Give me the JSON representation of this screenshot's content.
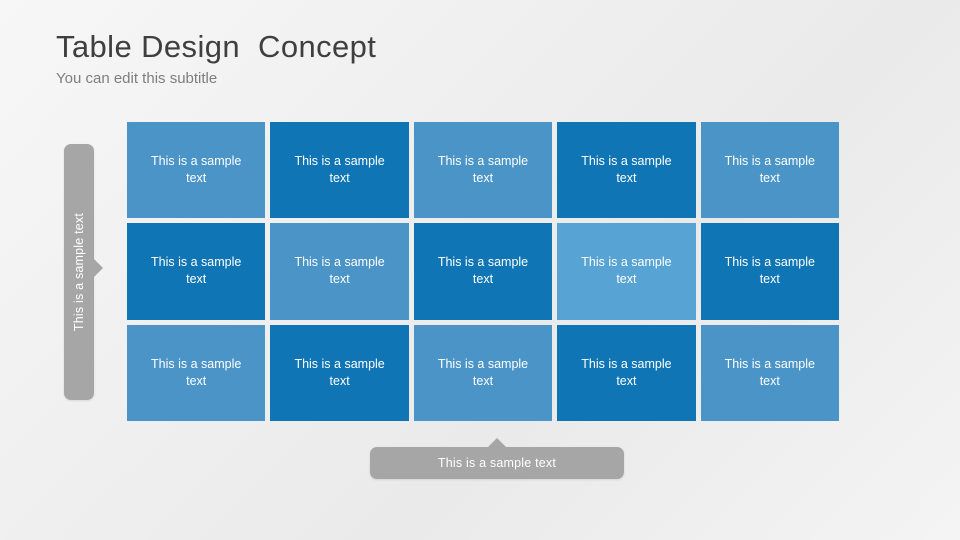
{
  "slide": {
    "background_top": "#f7f7f7",
    "background_bottom": "#eaeaea"
  },
  "header": {
    "title": "Table Design  Concept",
    "subtitle": "You can edit this subtitle",
    "title_color": "#3f3f3f",
    "subtitle_color": "#7e7e7e"
  },
  "row_label": {
    "text": "This is a sample text",
    "color": "#a6a6a6",
    "text_color": "#ffffff"
  },
  "col_label": {
    "text": "This is a sample text",
    "color": "#a6a6a6",
    "text_color": "#ffffff"
  },
  "palette": {
    "light_blue": "#4a94c8",
    "dark_blue": "#0f75b5",
    "highlight_blue": "#56a3d4",
    "cell_text": "#ffffff"
  },
  "grid": {
    "rows": 3,
    "columns": 5,
    "cells": [
      {
        "text": "This is a sample text",
        "color": "#4a94c8",
        "tone": "light"
      },
      {
        "text": "This is a sample text",
        "color": "#0f75b5",
        "tone": "dark"
      },
      {
        "text": "This is a sample text",
        "color": "#4a94c8",
        "tone": "light"
      },
      {
        "text": "This is a sample text",
        "color": "#0f75b5",
        "tone": "dark"
      },
      {
        "text": "This is a sample text",
        "color": "#4a94c8",
        "tone": "light"
      },
      {
        "text": "This is a sample text",
        "color": "#0f75b5",
        "tone": "dark"
      },
      {
        "text": "This is a sample text",
        "color": "#4a94c8",
        "tone": "light"
      },
      {
        "text": "This is a sample text",
        "color": "#0f75b5",
        "tone": "dark"
      },
      {
        "text": "This is a sample text",
        "color": "#56a3d4",
        "tone": "highlight"
      },
      {
        "text": "This is a sample text",
        "color": "#0f75b5",
        "tone": "dark"
      },
      {
        "text": "This is a sample text",
        "color": "#4a94c8",
        "tone": "light"
      },
      {
        "text": "This is a sample text",
        "color": "#0f75b5",
        "tone": "dark"
      },
      {
        "text": "This is a sample text",
        "color": "#4a94c8",
        "tone": "light"
      },
      {
        "text": "This is a sample text",
        "color": "#0f75b5",
        "tone": "dark"
      },
      {
        "text": "This is a sample text",
        "color": "#4a94c8",
        "tone": "light"
      }
    ]
  }
}
